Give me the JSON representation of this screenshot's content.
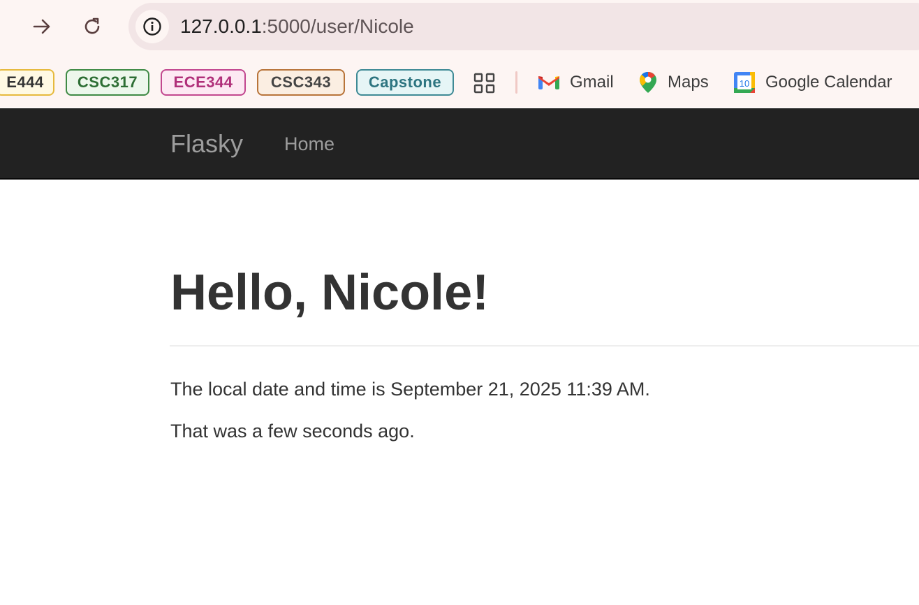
{
  "browser": {
    "url_host": "127.0.0.1",
    "url_path": ":5000/user/Nicole",
    "bookmarks": [
      {
        "label": "E444",
        "border": "#e6b93d",
        "bg": "#fff9e4",
        "color": "#333333"
      },
      {
        "label": "CSC317",
        "border": "#3f8a45",
        "bg": "#edf7ec",
        "color": "#2d6e34"
      },
      {
        "label": "ECE344",
        "border": "#c2478f",
        "bg": "#fde9f3",
        "color": "#b0307a"
      },
      {
        "label": "CSC343",
        "border": "#b8743a",
        "bg": "#fbeee2",
        "color": "#444444"
      },
      {
        "label": "Capstone",
        "border": "#3f8a95",
        "bg": "#e6f5f6",
        "color": "#2d7480"
      }
    ],
    "links": {
      "gmail": "Gmail",
      "maps": "Maps",
      "calendar": "Google Calendar",
      "calendar_day": "10"
    },
    "icons": {
      "forward": "arrow-right-icon",
      "reload": "reload-icon",
      "info": "info-icon",
      "apps": "apps-grid-icon"
    }
  },
  "navbar": {
    "brand": "Flasky",
    "home": "Home"
  },
  "page": {
    "heading": "Hello, Nicole!",
    "datetime_line": "The local date and time is September 21, 2025 11:39 AM.",
    "relative_line": "That was a few seconds ago."
  }
}
